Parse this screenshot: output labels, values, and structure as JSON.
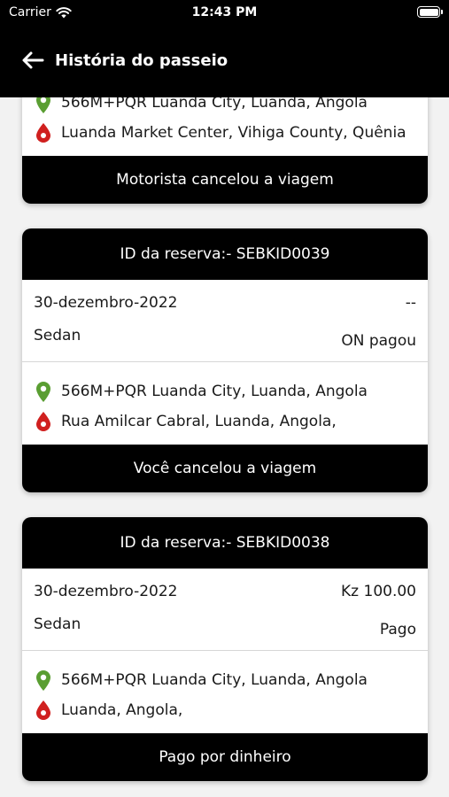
{
  "status_bar": {
    "carrier": "Carrier",
    "time": "12:43 PM"
  },
  "nav": {
    "title": "História do passeio"
  },
  "cards": [
    {
      "pickup": "566M+PQR Luanda City, Luanda, Angola",
      "dropoff": "Luanda Market Center, Vihiga County, Quênia",
      "status": "Motorista cancelou a viagem"
    },
    {
      "booking_id": "ID da reserva:- SEBKID0039",
      "date": "30-dezembro-2022",
      "price": "--",
      "vehicle": "Sedan",
      "payment": "ON pagou",
      "pickup": "566M+PQR Luanda City, Luanda, Angola",
      "dropoff": "Rua Amilcar Cabral, Luanda, Angola,",
      "status": "Você cancelou a viagem"
    },
    {
      "booking_id": "ID da reserva:- SEBKID0038",
      "date": "30-dezembro-2022",
      "price": "Kz 100.00",
      "vehicle": "Sedan",
      "payment": "Pago",
      "pickup": "566M+PQR Luanda City, Luanda, Angola",
      "dropoff": "Luanda, Angola,",
      "status": "Pago por dinheiro"
    }
  ],
  "colors": {
    "header": "#000000",
    "pickup_pin": "#5a9e32",
    "dropoff_pin": "#d0201f",
    "background": "#f2f2f2"
  }
}
